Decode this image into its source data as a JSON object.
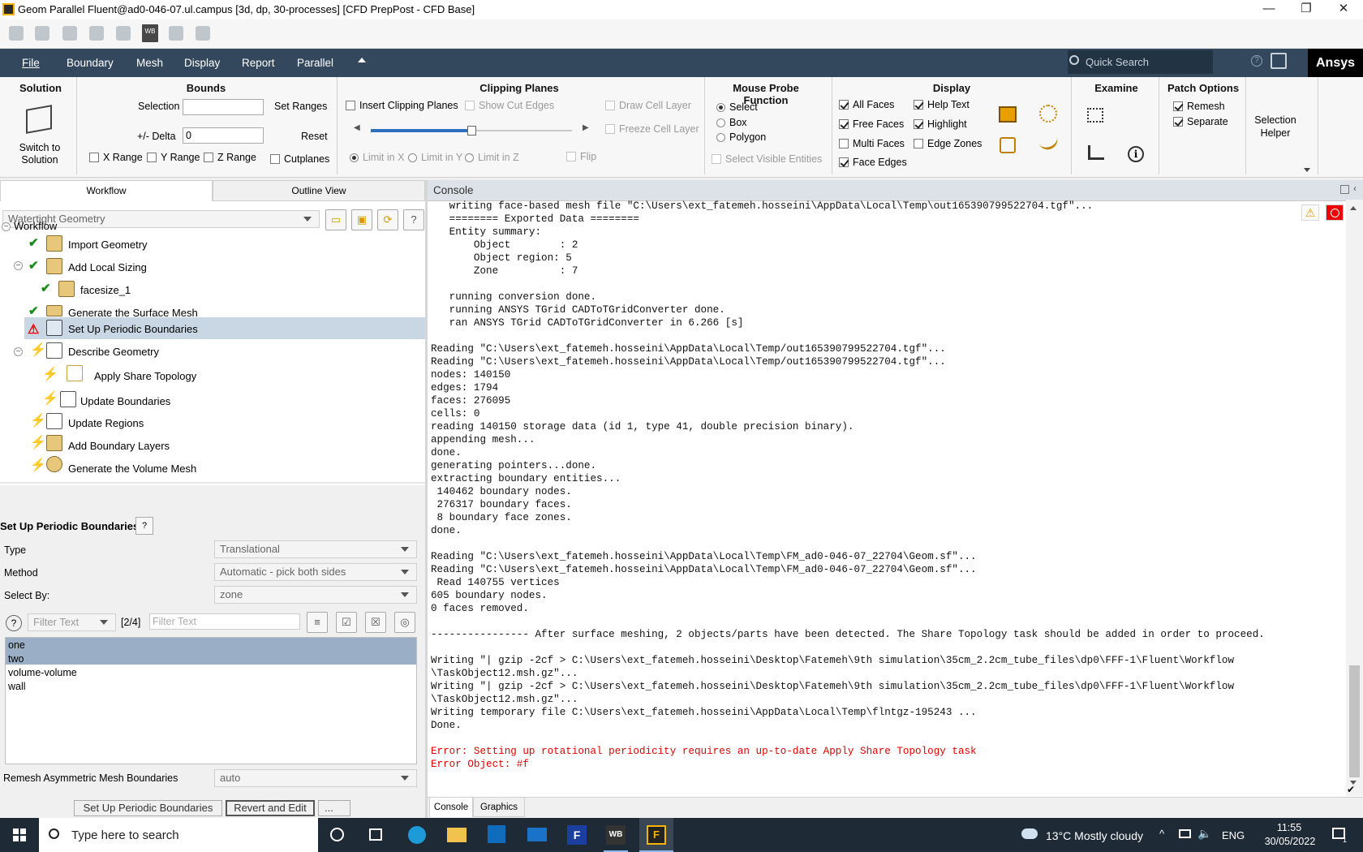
{
  "window": {
    "title": "Geom Parallel Fluent@ad0-046-07.ul.campus  [3d, dp, 30-processes] [CFD PrepPost - CFD Base]",
    "minimize": "—",
    "restore": "❐",
    "close": "✕"
  },
  "menubar": {
    "items": [
      "File",
      "Boundary",
      "Mesh",
      "Display",
      "Report",
      "Parallel"
    ],
    "search_placeholder": "Quick Search",
    "brand": "Ansys"
  },
  "ribbon": {
    "solution": {
      "title": "Solution",
      "button": "Switch to Solution"
    },
    "bounds": {
      "title": "Bounds",
      "selection_label": "Selection",
      "selection_value": "",
      "set_ranges": "Set Ranges",
      "delta_label": "+/- Delta",
      "delta_value": "0",
      "reset": "Reset",
      "x_range": "X Range",
      "y_range": "Y Range",
      "z_range": "Z Range",
      "cutplanes": "Cutplanes"
    },
    "clipping": {
      "title": "Clipping Planes",
      "insert": "Insert Clipping Planes",
      "show_cut_edges": "Show Cut Edges",
      "draw_cell_layer": "Draw Cell Layer",
      "freeze_cell_layer": "Freeze Cell Layer",
      "flip": "Flip",
      "limit_x": "Limit in X",
      "limit_y": "Limit in Y",
      "limit_z": "Limit in Z",
      "slider_value": 0.5
    },
    "probe": {
      "title": "Mouse Probe Function",
      "select": "Select",
      "box": "Box",
      "polygon": "Polygon",
      "select_visible": "Select Visible Entities"
    },
    "display": {
      "title": "Display",
      "all_faces": "All Faces",
      "free_faces": "Free Faces",
      "multi_faces": "Multi Faces",
      "face_edges": "Face Edges",
      "help_text": "Help Text",
      "highlight": "Highlight",
      "edge_zones": "Edge Zones"
    },
    "examine": {
      "title": "Examine"
    },
    "patch": {
      "title": "Patch Options",
      "remesh": "Remesh",
      "separate": "Separate"
    },
    "selection_helper": "Selection Helper"
  },
  "left": {
    "tabs": [
      "Workflow",
      "Outline View"
    ],
    "workflow_type": "Watertight Geometry",
    "tree_root": "Workflow",
    "tree": [
      {
        "label": "Import Geometry",
        "status": "done"
      },
      {
        "label": "Add Local Sizing",
        "status": "done"
      },
      {
        "label": "facesize_1",
        "status": "done"
      },
      {
        "label": "Generate the Surface Mesh",
        "status": "done"
      },
      {
        "label": "Set Up Periodic Boundaries",
        "status": "error"
      },
      {
        "label": "Describe Geometry",
        "status": "pending"
      },
      {
        "label": "Apply Share Topology",
        "status": "pending"
      },
      {
        "label": "Update Boundaries",
        "status": "pending"
      },
      {
        "label": "Update Regions",
        "status": "pending"
      },
      {
        "label": "Add Boundary Layers",
        "status": "pending"
      },
      {
        "label": "Generate the Volume Mesh",
        "status": "pending"
      }
    ],
    "task_title": "Set Up Periodic Boundaries",
    "type_label": "Type",
    "type_value": "Translational",
    "method_label": "Method",
    "method_value": "Automatic - pick both sides",
    "selectby_label": "Select By:",
    "selectby_value": "zone",
    "filter1_placeholder": "Filter Text",
    "filter_count": "[2/4]",
    "filter2_placeholder": "Filter Text",
    "list": [
      {
        "label": "one",
        "selected": true
      },
      {
        "label": "two",
        "selected": true
      },
      {
        "label": "volume-volume",
        "selected": false
      },
      {
        "label": "wall",
        "selected": false
      }
    ],
    "remesh_label": "Remesh Asymmetric Mesh Boundaries",
    "remesh_value": "auto",
    "btn_setup": "Set Up Periodic Boundaries",
    "btn_revert": "Revert and Edit",
    "btn_more": "..."
  },
  "console": {
    "title": "Console",
    "lines": [
      "   writing face-based mesh file \"C:\\Users\\ext_fatemeh.hosseini\\AppData\\Local\\Temp\\out165390799522704.tgf\"...",
      "   ======== Exported Data ========",
      "   Entity summary:",
      "       Object        : 2",
      "       Object region: 5",
      "       Zone          : 7",
      "",
      "   running conversion done.",
      "   running ANSYS TGrid CADToTGridConverter done.",
      "   ran ANSYS TGrid CADToTGridConverter in 6.266 [s]",
      "",
      "Reading \"C:\\Users\\ext_fatemeh.hosseini\\AppData\\Local\\Temp/out165390799522704.tgf\"...",
      "Reading \"C:\\Users\\ext_fatemeh.hosseini\\AppData\\Local\\Temp/out165390799522704.tgf\"...",
      "nodes: 140150",
      "edges: 1794",
      "faces: 276095",
      "cells: 0",
      "reading 140150 storage data (id 1, type 41, double precision binary).",
      "appending mesh...",
      "done.",
      "generating pointers...done.",
      "extracting boundary entities...",
      " 140462 boundary nodes.",
      " 276317 boundary faces.",
      " 8 boundary face zones.",
      "done.",
      "",
      "Reading \"C:\\Users\\ext_fatemeh.hosseini\\AppData\\Local\\Temp\\FM_ad0-046-07_22704\\Geom.sf\"...",
      "Reading \"C:\\Users\\ext_fatemeh.hosseini\\AppData\\Local\\Temp\\FM_ad0-046-07_22704\\Geom.sf\"...",
      " Read 140755 vertices",
      "605 boundary nodes.",
      "0 faces removed.",
      "",
      "---------------- After surface meshing, 2 objects/parts have been detected. The Share Topology task should be added in order to proceed.",
      "",
      "Writing \"| gzip -2cf > C:\\Users\\ext_fatemeh.hosseini\\Desktop\\Fatemeh\\9th simulation\\35cm_2.2cm_tube_files\\dp0\\FFF-1\\Fluent\\Workflow",
      "\\TaskObject12.msh.gz\"...",
      "Writing \"| gzip -2cf > C:\\Users\\ext_fatemeh.hosseini\\Desktop\\Fatemeh\\9th simulation\\35cm_2.2cm_tube_files\\dp0\\FFF-1\\Fluent\\Workflow",
      "\\TaskObject12.msh.gz\"...",
      "Writing temporary file C:\\Users\\ext_fatemeh.hosseini\\AppData\\Local\\Temp\\flntgz-195243 ...",
      "Done.",
      "",
      ""
    ],
    "error_lines": [
      "Error: Setting up rotational periodicity requires an up-to-date Apply Share Topology task",
      "Error Object: #f"
    ],
    "bottom_tabs": [
      "Console",
      "Graphics"
    ]
  },
  "taskbar": {
    "search_placeholder": "Type here to search",
    "weather": "13°C  Mostly cloudy",
    "lang": "ENG",
    "time": "11:55",
    "date": "30/05/2022",
    "notif": "1",
    "apps": [
      "WB",
      "F"
    ]
  }
}
